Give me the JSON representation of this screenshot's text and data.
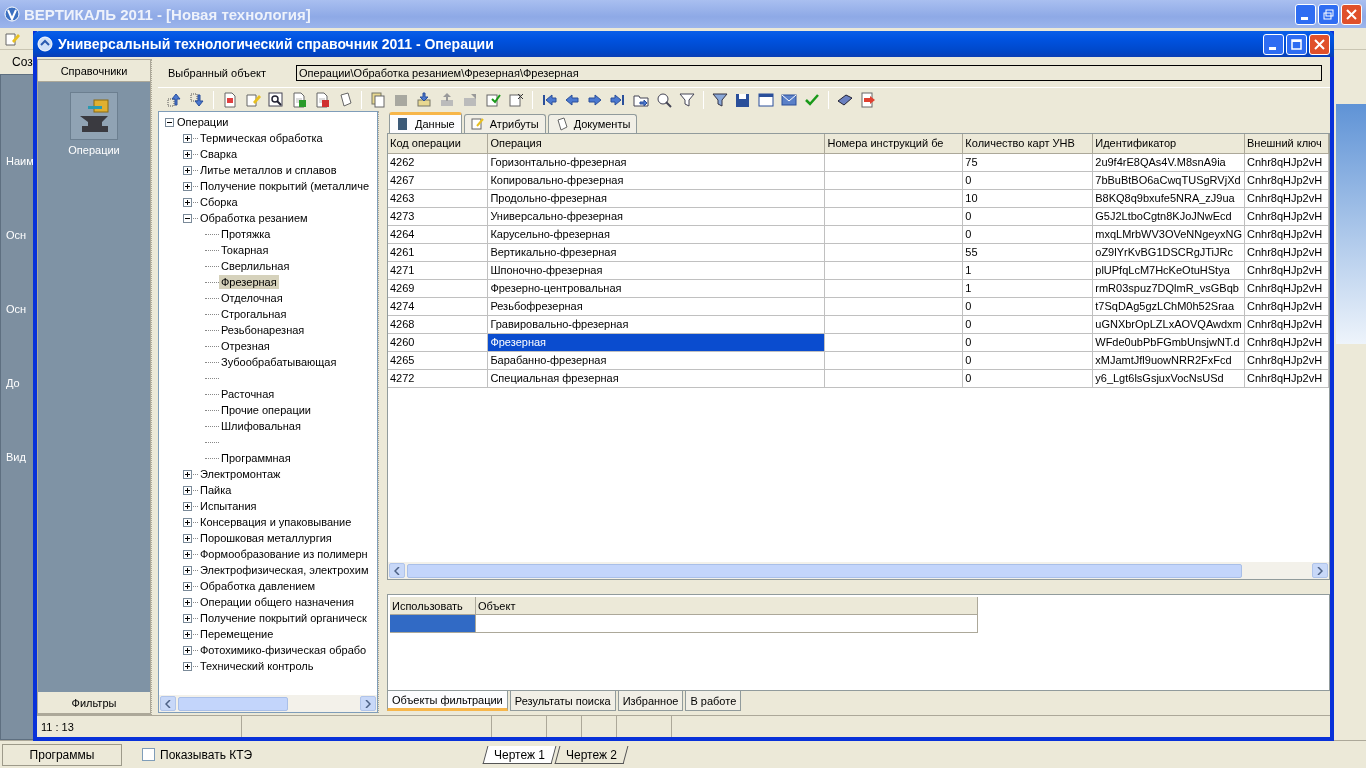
{
  "app": {
    "title": "ВЕРТИКАЛЬ 2011 - [Новая технология]",
    "toolbar_label": "Соз",
    "side_labels": [
      "Наим",
      "Осн",
      "Осн",
      "До",
      "Вид"
    ],
    "programs_button": "Программы",
    "show_kte": {
      "label": "Показывать КТЭ",
      "checked": false
    },
    "sheet_tabs": [
      {
        "label": "Чертеж 1",
        "selected": true
      },
      {
        "label": "Чертеж 2",
        "selected": false
      }
    ]
  },
  "dialog": {
    "title": "Универсальный технологический справочник 2011 - Операции",
    "sidebar": {
      "header": "Справочники",
      "item": "Операции",
      "footer": "Фильтры"
    },
    "selected_object": {
      "label": "Выбранный объект",
      "value": "Операции\\Обработка резанием\\Фрезерная\\Фрезерная"
    },
    "tree": [
      {
        "label": "Операции",
        "expanded": true,
        "selected": false,
        "children": [
          {
            "label": "Термическая обработка",
            "expanded": false,
            "selected": false
          },
          {
            "label": "Сварка",
            "expanded": false,
            "selected": false
          },
          {
            "label": "Литье металлов и сплавов",
            "expanded": false,
            "selected": false
          },
          {
            "label": "Получение покрытий (металличе",
            "expanded": false,
            "selected": false
          },
          {
            "label": "Сборка",
            "expanded": false,
            "selected": false
          },
          {
            "label": "Обработка резанием",
            "expanded": true,
            "selected": false,
            "children": [
              {
                "kind": "item",
                "label": "Протяжка",
                "selected": false
              },
              {
                "kind": "item",
                "label": "Токарная",
                "selected": false
              },
              {
                "kind": "item",
                "label": "Сверлильная",
                "selected": false
              },
              {
                "kind": "item",
                "label": "Фрезерная",
                "selected": true
              },
              {
                "kind": "item",
                "label": "Отделочная",
                "selected": false
              },
              {
                "kind": "item",
                "label": "Строгальная",
                "selected": false
              },
              {
                "kind": "item",
                "label": "Резьбонарезная",
                "selected": false
              },
              {
                "kind": "item",
                "label": "Отрезная",
                "selected": false
              },
              {
                "kind": "item",
                "label": "Зубообрабатывающая",
                "selected": false
              },
              {
                "kind": "blank",
                "selected": false
              },
              {
                "kind": "item",
                "label": "Расточная",
                "selected": false
              },
              {
                "kind": "item",
                "label": "Прочие операции",
                "selected": false
              },
              {
                "kind": "item",
                "label": "Шлифовальная",
                "selected": false
              },
              {
                "kind": "blank",
                "selected": false
              },
              {
                "kind": "item",
                "label": "Программная",
                "selected": false
              }
            ]
          },
          {
            "label": "Электромонтаж",
            "expanded": false,
            "selected": false
          },
          {
            "label": "Пайка",
            "expanded": false,
            "selected": false
          },
          {
            "label": "Испытания",
            "expanded": false,
            "selected": false
          },
          {
            "label": "Консервация и упаковывание",
            "expanded": false,
            "selected": false
          },
          {
            "label": "Порошковая металлургия",
            "expanded": false,
            "selected": false
          },
          {
            "label": "Формообразование из полимерн",
            "expanded": false,
            "selected": false
          },
          {
            "label": "Электрофизическая, электрохим",
            "expanded": false,
            "selected": false
          },
          {
            "label": "Обработка давлением",
            "expanded": false,
            "selected": false
          },
          {
            "label": "Операции общего назначения",
            "expanded": false,
            "selected": false
          },
          {
            "label": "Получение покрытий органическ",
            "expanded": false,
            "selected": false
          },
          {
            "label": "Перемещение",
            "expanded": false,
            "selected": false
          },
          {
            "label": "Фотохимико-физическая обрабо",
            "expanded": false,
            "selected": false
          },
          {
            "label": "Технический контроль",
            "expanded": false,
            "selected": false
          }
        ]
      }
    ],
    "tabs": [
      {
        "label": "Данные",
        "selected": true
      },
      {
        "label": "Атрибуты",
        "selected": false
      },
      {
        "label": "Документы",
        "selected": false
      }
    ],
    "table": {
      "columns": [
        "Код операции",
        "Операция",
        "Номера инструкций бе",
        "Количество карт УНВ",
        "Идентификатор",
        "Внешний ключ"
      ],
      "rows": [
        {
          "selected": false,
          "cells": [
            "4262",
            "Горизонтально-фрезерная",
            "",
            "75",
            "2u9f4rE8QAs4V.M8snA9ia",
            "Cnhr8qHJp2vH"
          ]
        },
        {
          "selected": false,
          "cells": [
            "4267",
            "Копировально-фрезерная",
            "",
            "0",
            "7bBuBtBO6aCwqTUSgRVjXd",
            "Cnhr8qHJp2vH"
          ]
        },
        {
          "selected": false,
          "cells": [
            "4263",
            "Продольно-фрезерная",
            "",
            "10",
            "B8KQ8q9bxufe5NRA_zJ9ua",
            "Cnhr8qHJp2vH"
          ]
        },
        {
          "selected": false,
          "cells": [
            "4273",
            "Универсально-фрезерная",
            "",
            "0",
            "G5J2LtboCgtn8KJoJNwEcd",
            "Cnhr8qHJp2vH"
          ]
        },
        {
          "selected": false,
          "cells": [
            "4264",
            "Карусельно-фрезерная",
            "",
            "0",
            "mxqLMrbWV3OVeNNgeyxNG",
            "Cnhr8qHJp2vH"
          ]
        },
        {
          "selected": false,
          "cells": [
            "4261",
            "Вертикально-фрезерная",
            "",
            "55",
            "oZ9lYrKvBG1DSCRgJTiJRc",
            "Cnhr8qHJp2vH"
          ]
        },
        {
          "selected": false,
          "cells": [
            "4271",
            "Шпоночно-фрезерная",
            "",
            "1",
            "plUPfqLcM7HcKeOtuHStya",
            "Cnhr8qHJp2vH"
          ]
        },
        {
          "selected": false,
          "cells": [
            "4269",
            "Фрезерно-центровальная",
            "",
            "1",
            "rmR03spuz7DQlmR_vsGBqb",
            "Cnhr8qHJp2vH"
          ]
        },
        {
          "selected": false,
          "cells": [
            "4274",
            "Резьбофрезерная",
            "",
            "0",
            "t7SqDAg5gzLChM0h52Sraa",
            "Cnhr8qHJp2vH"
          ]
        },
        {
          "selected": false,
          "cells": [
            "4268",
            "Гравировально-фрезерная",
            "",
            "0",
            "uGNXbrOpLZLxAOVQAwdxm",
            "Cnhr8qHJp2vH"
          ]
        },
        {
          "selected": true,
          "cells": [
            "4260",
            "Фрезерная",
            "",
            "0",
            "WFde0ubPbFGmbUnsjwNT.d",
            "Cnhr8qHJp2vH"
          ]
        },
        {
          "selected": false,
          "cells": [
            "4265",
            "Барабанно-фрезерная",
            "",
            "0",
            "xMJamtJfl9uowNRR2FxFcd",
            "Cnhr8qHJp2vH"
          ]
        },
        {
          "selected": false,
          "cells": [
            "4272",
            "Специальная фрезерная",
            "",
            "0",
            "y6_Lgt6lsGsjuxVocNsUSd",
            "Cnhr8qHJp2vH"
          ]
        }
      ]
    },
    "filter_table": {
      "columns": [
        "Использовать",
        "Объект"
      ],
      "rows": [
        {
          "selected": true
        }
      ]
    },
    "bottom_tabs": [
      {
        "label": "Объекты фильтрации",
        "selected": true
      },
      {
        "label": "Результаты поиска",
        "selected": false
      },
      {
        "label": "Избранное",
        "selected": false
      },
      {
        "label": "В работе",
        "selected": false
      }
    ],
    "status_bar": [
      "11 : 13"
    ]
  }
}
